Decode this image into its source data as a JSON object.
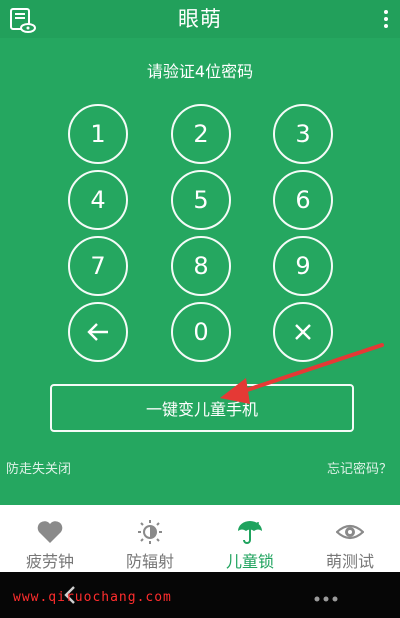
{
  "header": {
    "title": "眼萌",
    "left_icon": "eye-notes-icon",
    "menu_icon": "more-vertical-icon"
  },
  "prompt": "请验证4位密码",
  "keypad": {
    "keys": [
      "1",
      "2",
      "3",
      "4",
      "5",
      "6",
      "7",
      "8",
      "9",
      "←",
      "0",
      "×"
    ]
  },
  "main_button": "一键变儿童手机",
  "links": {
    "left": "防走失关闭",
    "right": "忘记密码？"
  },
  "bottom_nav": [
    {
      "label": "疲劳钟",
      "icon": "heart-icon"
    },
    {
      "label": "防辐射",
      "icon": "radiation-icon"
    },
    {
      "label": "儿童锁",
      "icon": "umbrella-icon",
      "active": true
    },
    {
      "label": "萌测试",
      "icon": "eye-icon"
    }
  ],
  "watermark": "www.qiruochang.com",
  "colors": {
    "background": "#25a760",
    "header": "#22a05b",
    "active_tab": "#1fa35e",
    "inactive_tab": "#777777",
    "arrow": "#e53935"
  }
}
